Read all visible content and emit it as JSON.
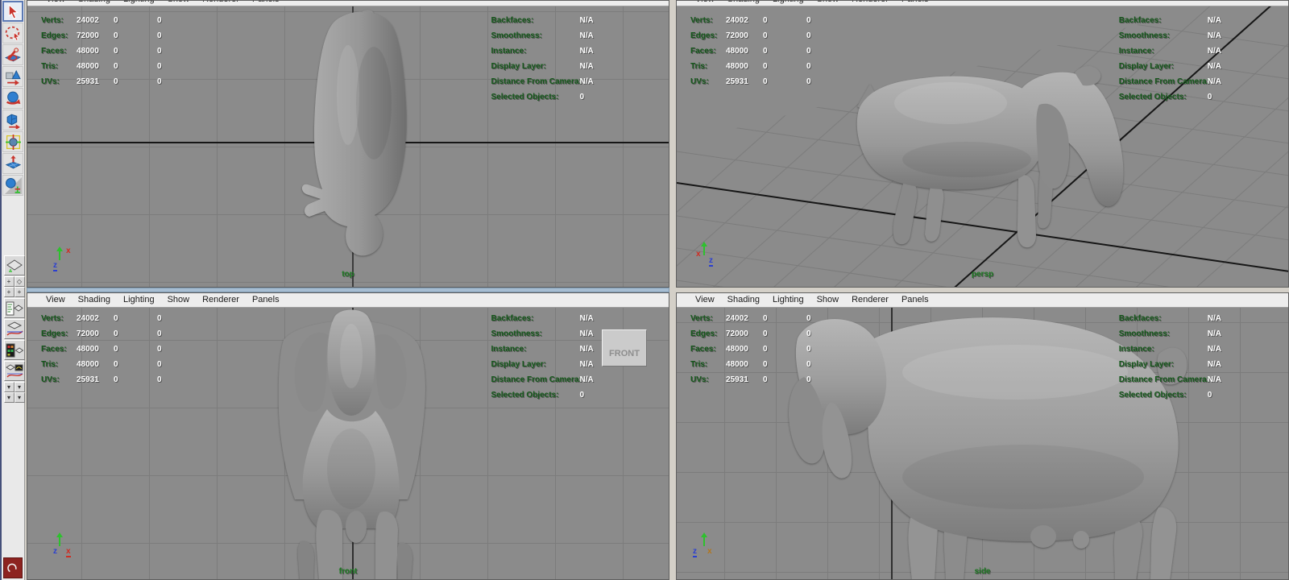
{
  "app": {
    "name": "Maya four-view modeling layout",
    "model": "goat polygon mesh"
  },
  "viewport_menu": [
    {
      "label": "View"
    },
    {
      "label": "Shading"
    },
    {
      "label": "Lighting"
    },
    {
      "label": "Show"
    },
    {
      "label": "Renderer"
    },
    {
      "label": "Panels"
    }
  ],
  "hud": {
    "poly_rows": [
      {
        "label": "Verts:",
        "value": "24002",
        "c1": "0",
        "c2": "0"
      },
      {
        "label": "Edges:",
        "value": "72000",
        "c1": "0",
        "c2": "0"
      },
      {
        "label": "Faces:",
        "value": "48000",
        "c1": "0",
        "c2": "0"
      },
      {
        "label": "Tris:",
        "value": "48000",
        "c1": "0",
        "c2": "0"
      },
      {
        "label": "UVs:",
        "value": "25931",
        "c1": "0",
        "c2": "0"
      }
    ],
    "object_rows": [
      {
        "label": "Backfaces:",
        "value": "N/A"
      },
      {
        "label": "Smoothness:",
        "value": "N/A"
      },
      {
        "label": "Instance:",
        "value": "N/A"
      },
      {
        "label": "Display Layer:",
        "value": "N/A"
      },
      {
        "label": "Distance From Camera:",
        "value": "N/A"
      },
      {
        "label": "Selected Objects:",
        "value": "0"
      }
    ]
  },
  "viewports": [
    {
      "camera": "top"
    },
    {
      "camera": "persp"
    },
    {
      "camera": "front"
    },
    {
      "camera": "side"
    }
  ],
  "tooltip": {
    "text": "FRONT"
  },
  "axis": {
    "x": "x",
    "y": "y",
    "z": "z"
  },
  "toolbar": {
    "tools": [
      "select-tool",
      "lasso-select-tool",
      "paint-select-tool",
      "move-tool",
      "rotate-tool",
      "scale-tool",
      "universal-manipulator-tool",
      "soft-modification-tool",
      "show-manipulator-tool"
    ],
    "layout_buttons": [
      "single-pane-layout",
      "four-pane-layout",
      "outliner-persp-layout",
      "persp-graph-layout",
      "hypershade-persp-layout",
      "persp-uv-layout",
      "layout-menu-1",
      "layout-menu-2",
      "layout-menu-3",
      "layout-menu-4"
    ]
  },
  "colors": {
    "viewport_bg": "#8b8b8b",
    "grid_line": "#7c7c7c",
    "axis_line": "#161616",
    "hud_label_green": "#15591b",
    "hud_value_white": "#ffffff",
    "camera_label_green": "#1d7a22",
    "menu_bg": "#ededed",
    "active_panel_blue": "#a6bdd2",
    "axis_x_red": "#cf2c22",
    "axis_y_green": "#2dc12d",
    "axis_z_blue": "#2b3fd0",
    "axis_x_dim": "#b3761c"
  }
}
